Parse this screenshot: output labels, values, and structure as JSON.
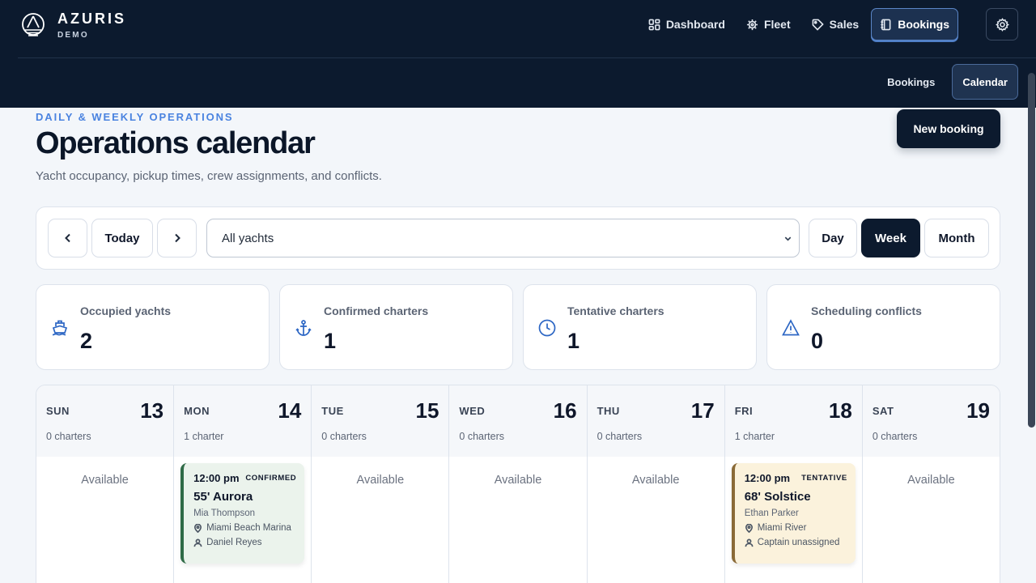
{
  "brand": {
    "name": "AZURIS",
    "sub": "DEMO"
  },
  "nav": {
    "items": [
      {
        "label": "Dashboard",
        "icon": "grid-icon"
      },
      {
        "label": "Fleet",
        "icon": "helm-icon"
      },
      {
        "label": "Sales",
        "icon": "tag-icon"
      },
      {
        "label": "Bookings",
        "icon": "notebook-icon",
        "active": true
      }
    ],
    "settings_icon": "gear-icon"
  },
  "subnav": {
    "items": [
      {
        "label": "Bookings"
      },
      {
        "label": "Calendar",
        "active": true
      }
    ]
  },
  "header": {
    "eyebrow": "DAILY & WEEKLY OPERATIONS",
    "title": "Operations calendar",
    "subtitle": "Yacht occupancy, pickup times, crew assignments, and conflicts.",
    "new_booking": "New booking"
  },
  "toolbar": {
    "prev_icon": "chevron-left-icon",
    "today": "Today",
    "next_icon": "chevron-right-icon",
    "filter_value": "All yachts",
    "views": [
      "Day",
      "Week",
      "Month"
    ],
    "active_view": "Week"
  },
  "stats": [
    {
      "label": "Occupied yachts",
      "value": "2",
      "icon": "boat-icon"
    },
    {
      "label": "Confirmed charters",
      "value": "1",
      "icon": "anchor-icon"
    },
    {
      "label": "Tentative charters",
      "value": "1",
      "icon": "clock-icon"
    },
    {
      "label": "Scheduling conflicts",
      "value": "0",
      "icon": "warning-icon"
    }
  ],
  "calendar": {
    "available_label": "Available",
    "days": [
      {
        "dow": "SUN",
        "num": "13",
        "count": "0 charters"
      },
      {
        "dow": "MON",
        "num": "14",
        "count": "1 charter"
      },
      {
        "dow": "TUE",
        "num": "15",
        "count": "0 charters"
      },
      {
        "dow": "WED",
        "num": "16",
        "count": "0 charters"
      },
      {
        "dow": "THU",
        "num": "17",
        "count": "0 charters"
      },
      {
        "dow": "FRI",
        "num": "18",
        "count": "1 charter"
      },
      {
        "dow": "SAT",
        "num": "19",
        "count": "0 charters"
      }
    ],
    "events": {
      "mon": {
        "time": "12:00 pm",
        "status": "CONFIRMED",
        "yacht": "55' Aurora",
        "client": "Mia Thompson",
        "location": "Miami Beach Marina",
        "captain": "Daniel Reyes",
        "color": "#2f6b47"
      },
      "fri": {
        "time": "12:00 pm",
        "status": "TENTATIVE",
        "yacht": "68' Solstice",
        "client": "Ethan Parker",
        "location": "Miami River",
        "captain": "Captain unassigned",
        "color": "#8a6a37"
      }
    }
  },
  "colors": {
    "nav_bg": "#0c1a2e",
    "accent": "#4a83e0",
    "confirmed": "#2f6b47",
    "tentative": "#8a6a37"
  }
}
